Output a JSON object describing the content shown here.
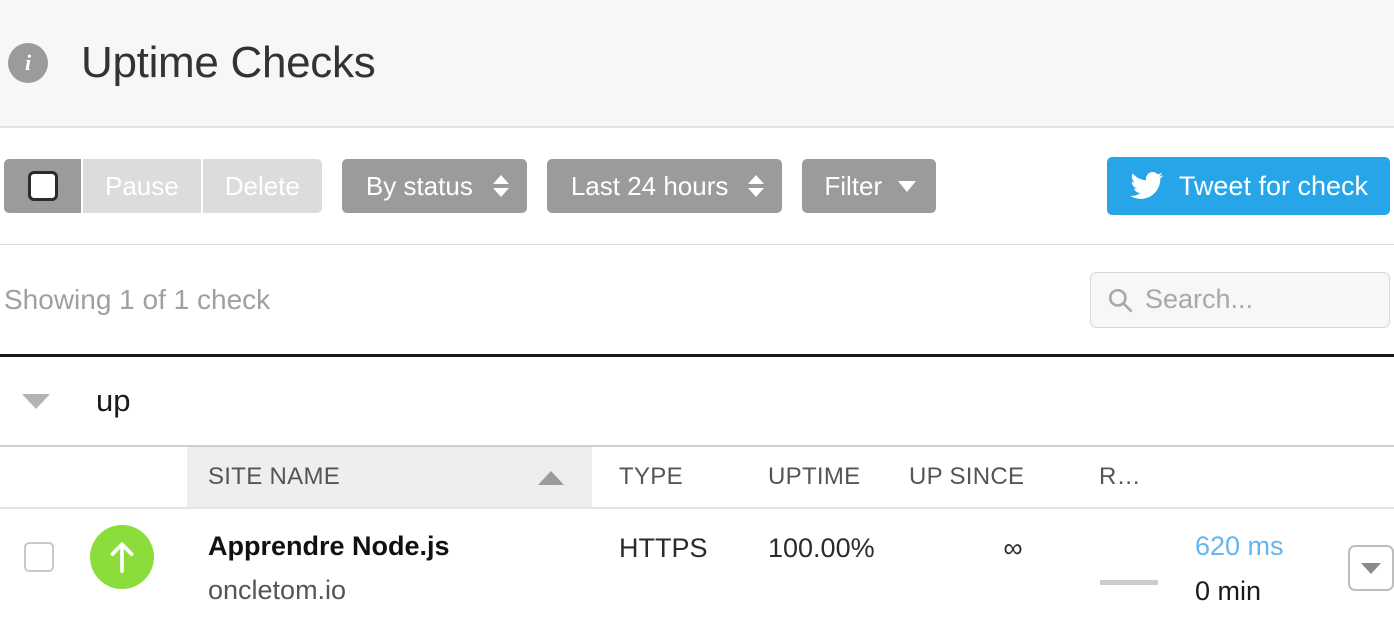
{
  "header": {
    "icon": "info-icon",
    "title": "Uptime Checks"
  },
  "toolbar": {
    "select_all_checkbox": "",
    "pause_label": "Pause",
    "delete_label": "Delete",
    "status_select_label": "By status",
    "range_select_label": "Last 24 hours",
    "filter_label": "Filter",
    "tweet_label": "Tweet for check",
    "tweet_icon": "twitter-bird-icon",
    "tweet_color": "#26a6e8"
  },
  "subbar": {
    "showing_text": "Showing 1 of 1 check",
    "search_placeholder": "Search...",
    "search_value": "",
    "search_icon": "search-icon"
  },
  "group": {
    "caret_icon": "chevron-down-icon",
    "label": "up"
  },
  "table": {
    "columns": [
      {
        "key": "check",
        "label": ""
      },
      {
        "key": "site",
        "label": "SITE NAME",
        "sorted": "asc"
      },
      {
        "key": "type",
        "label": "TYPE"
      },
      {
        "key": "uptime",
        "label": "UPTIME"
      },
      {
        "key": "since",
        "label": "UP SINCE"
      },
      {
        "key": "response",
        "label": "R…"
      }
    ],
    "rows": [
      {
        "selected": false,
        "status": "up",
        "status_color": "#8cdd3c",
        "site_name": "Apprendre Node.js",
        "site_url": "oncletom.io",
        "type": "HTTPS",
        "uptime": "100.00%",
        "up_since": "∞",
        "response_time": "620 ms",
        "response_time_color": "#64b5f0",
        "downtime": "0 min",
        "menu_icon": "chevron-down-icon"
      }
    ]
  }
}
